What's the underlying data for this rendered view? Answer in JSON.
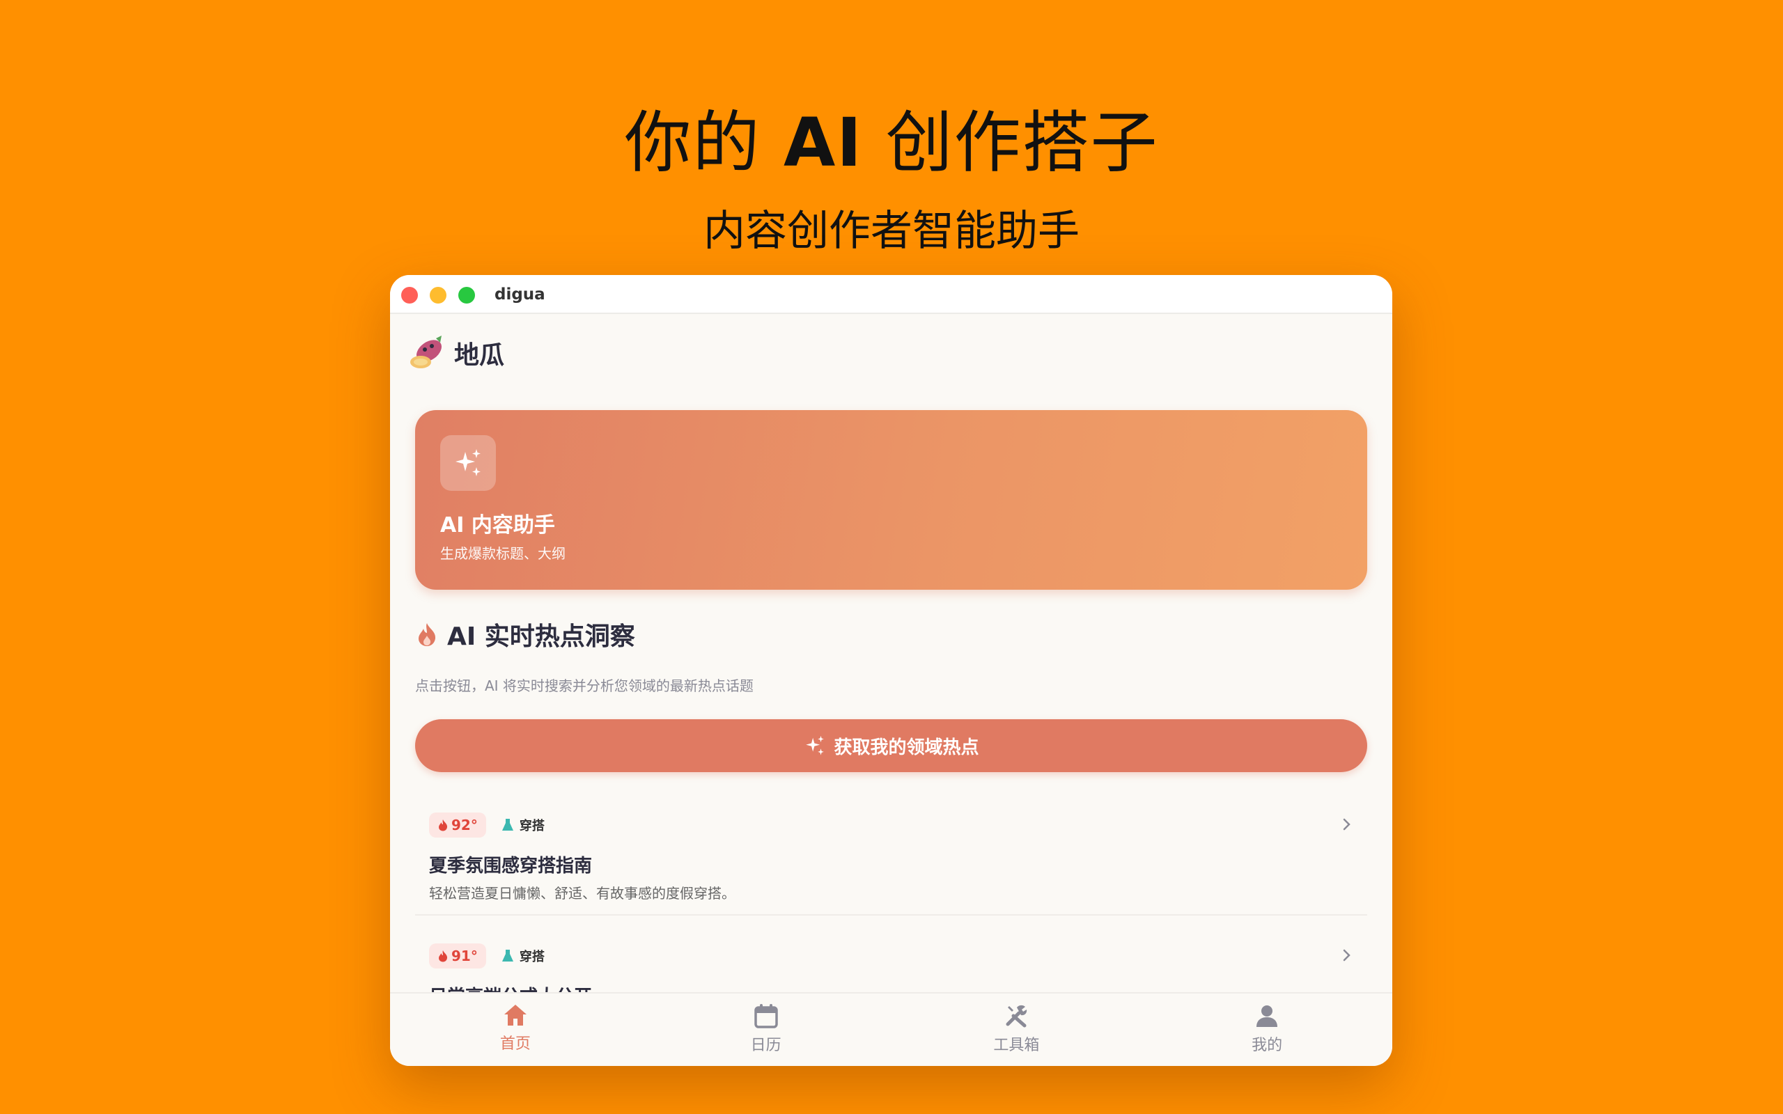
{
  "promo": {
    "title_prefix": "你的 ",
    "title_bold": "AI",
    "title_suffix": " 创作搭子",
    "subtitle": "内容创作者智能助手"
  },
  "window": {
    "title": "digua"
  },
  "app": {
    "name": "地瓜",
    "logo_icon": "sweet-potato-icon"
  },
  "hero": {
    "title": "AI 内容助手",
    "description": "生成爆款标题、大纲",
    "icon": "sparkles-icon"
  },
  "hot_section": {
    "title": "AI 实时热点洞察",
    "description": "点击按钮，AI 将实时搜索并分析您领域的最新热点话题",
    "button_label": "获取我的领域热点"
  },
  "topics": [
    {
      "heat": "92°",
      "category": "穿搭",
      "title": "夏季氛围感穿搭指南",
      "description": "轻松营造夏日慵懒、舒适、有故事感的度假穿搭。"
    },
    {
      "heat": "91°",
      "category": "穿搭",
      "title": "日常高端公式大公开",
      "description": ""
    }
  ],
  "tabs": [
    {
      "label": "首页",
      "icon": "home-icon",
      "active": true
    },
    {
      "label": "日历",
      "icon": "calendar-icon",
      "active": false
    },
    {
      "label": "工具箱",
      "icon": "tools-icon",
      "active": false
    },
    {
      "label": "我的",
      "icon": "person-icon",
      "active": false
    }
  ],
  "colors": {
    "background": "#ff9000",
    "accent": "#e07a62",
    "heat": "#e0453a"
  }
}
